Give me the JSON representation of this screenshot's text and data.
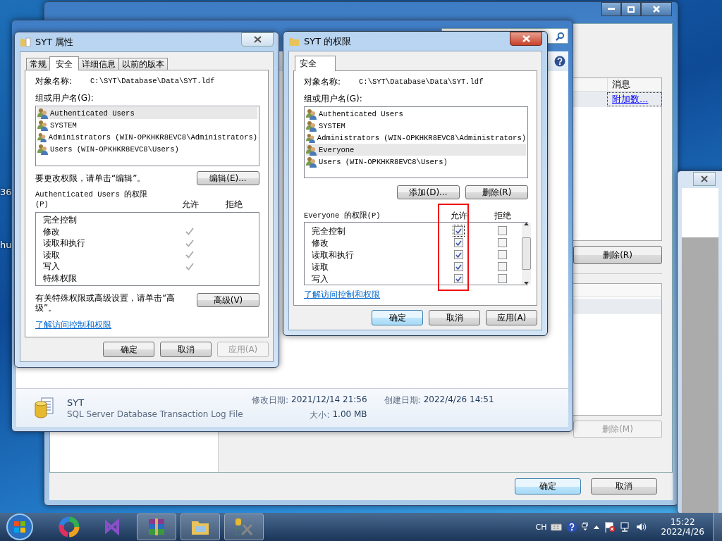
{
  "desktop": {
    "labels": [
      "36",
      "hu"
    ]
  },
  "attach_window": {
    "column_header": "消息",
    "message_link": "附加数...",
    "remove_button": {
      "label": "删除(R)",
      "disabled": false
    },
    "remove_module_button": {
      "label": "删除(M)",
      "disabled": true
    },
    "ok_button": "确定",
    "cancel_button": "取消"
  },
  "explorer": {
    "file_name": "SYT",
    "file_type": "SQL Server Database Transaction Log File",
    "fields": [
      {
        "label": "修改日期:",
        "value": "2021/12/14 21:56"
      },
      {
        "label": "创建日期:",
        "value": "2022/4/26 14:51"
      },
      {
        "label": "大小:",
        "value": "1.00 MB"
      }
    ]
  },
  "properties_dialog": {
    "title": "SYT 属性",
    "tabs": [
      {
        "label": "常规",
        "selected": false
      },
      {
        "label": "安全",
        "selected": true
      },
      {
        "label": "详细信息",
        "selected": false
      },
      {
        "label": "以前的版本",
        "selected": false
      }
    ],
    "object_label": "对象名称:",
    "object_path": "C:\\SYT\\Database\\Data\\SYT.ldf",
    "group_label": "组或用户名(G):",
    "users": [
      {
        "name": "Authenticated Users",
        "selected": true
      },
      {
        "name": "SYSTEM",
        "selected": false
      },
      {
        "name": "Administrators (WIN-OPKHKR8EVC8\\Administrators)",
        "selected": false
      },
      {
        "name": "Users (WIN-OPKHKR8EVC8\\Users)",
        "selected": false
      }
    ],
    "change_hint": "要更改权限，请单击“编辑”。",
    "edit_button": "编辑(E)...",
    "permissions_label": "Authenticated Users 的权限 (P)",
    "allow_header": "允许",
    "deny_header": "拒绝",
    "permissions": [
      {
        "name": "完全控制",
        "allow": false
      },
      {
        "name": "修改",
        "allow": true
      },
      {
        "name": "读取和执行",
        "allow": true
      },
      {
        "name": "读取",
        "allow": true
      },
      {
        "name": "写入",
        "allow": true
      },
      {
        "name": "特殊权限",
        "allow": false
      }
    ],
    "advanced_hint": "有关特殊权限或高级设置，请单击“高级”。",
    "advanced_button": "高级(V)",
    "help_link": "了解访问控制和权限",
    "buttons": [
      {
        "label": "确定",
        "disabled": false
      },
      {
        "label": "取消",
        "disabled": false
      },
      {
        "label": "应用(A)",
        "disabled": true
      }
    ]
  },
  "permissions_dialog": {
    "title": "SYT 的权限",
    "tabs": [
      {
        "label": "安全",
        "selected": true
      }
    ],
    "object_label": "对象名称:",
    "object_path": "C:\\SYT\\Database\\Data\\SYT.ldf",
    "group_label": "组或用户名(G):",
    "users": [
      {
        "name": "Authenticated Users",
        "selected": false
      },
      {
        "name": "SYSTEM",
        "selected": false
      },
      {
        "name": "Administrators (WIN-OPKHKR8EVC8\\Administrators)",
        "selected": false
      },
      {
        "name": "Everyone",
        "selected": true
      },
      {
        "name": "Users (WIN-OPKHKR8EVC8\\Users)",
        "selected": false
      }
    ],
    "add_button": "添加(D)...",
    "remove_button": "删除(R)",
    "permissions_label": "Everyone 的权限(P)",
    "allow_header": "允许",
    "deny_header": "拒绝",
    "allow_column_highlighted": true,
    "permissions": [
      {
        "name": "完全控制",
        "allow": true,
        "deny": false
      },
      {
        "name": "修改",
        "allow": true,
        "deny": false
      },
      {
        "name": "读取和执行",
        "allow": true,
        "deny": false
      },
      {
        "name": "读取",
        "allow": true,
        "deny": false
      },
      {
        "name": "写入",
        "allow": true,
        "deny": false
      }
    ],
    "help_link": "了解访问控制和权限",
    "buttons": [
      {
        "label": "确定",
        "disabled": false,
        "default": true
      },
      {
        "label": "取消",
        "disabled": false,
        "default": false
      },
      {
        "label": "应用(A)",
        "disabled": false,
        "default": false
      }
    ]
  },
  "taskbar": {
    "apps": [
      {
        "kind": "ring",
        "open": false
      },
      {
        "kind": "studio",
        "open": false
      },
      {
        "kind": "archive",
        "open": true
      },
      {
        "kind": "folder",
        "open": true
      },
      {
        "kind": "tools",
        "open": true
      }
    ],
    "language": "CH",
    "time": "15:22",
    "date": "2022/4/26"
  }
}
